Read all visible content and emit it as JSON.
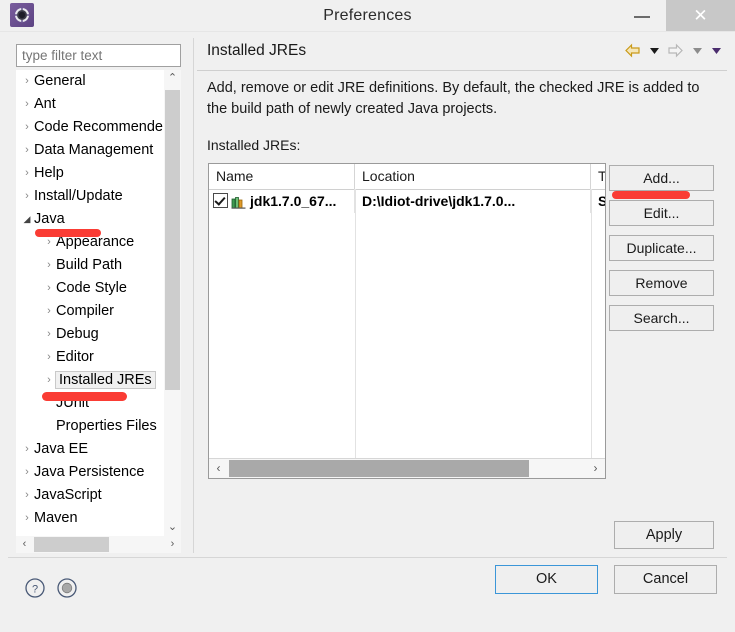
{
  "window": {
    "title": "Preferences",
    "icon": "eclipse-gear-icon",
    "minimize_label": "–",
    "maximize_label": "□",
    "close_label": "✕"
  },
  "sidebar": {
    "filter_placeholder": "type filter text",
    "filter_value": "",
    "items": [
      {
        "label": "General",
        "level": 0,
        "arrow": "collapsed"
      },
      {
        "label": "Ant",
        "level": 0,
        "arrow": "collapsed"
      },
      {
        "label": "Code Recommenders",
        "level": 0,
        "arrow": "collapsed"
      },
      {
        "label": "Data Management",
        "level": 0,
        "arrow": "collapsed"
      },
      {
        "label": "Help",
        "level": 0,
        "arrow": "collapsed"
      },
      {
        "label": "Install/Update",
        "level": 0,
        "arrow": "collapsed"
      },
      {
        "label": "Java",
        "level": 0,
        "arrow": "expanded"
      },
      {
        "label": "Appearance",
        "level": 1,
        "arrow": "collapsed"
      },
      {
        "label": "Build Path",
        "level": 1,
        "arrow": "collapsed"
      },
      {
        "label": "Code Style",
        "level": 1,
        "arrow": "collapsed"
      },
      {
        "label": "Compiler",
        "level": 1,
        "arrow": "collapsed"
      },
      {
        "label": "Debug",
        "level": 1,
        "arrow": "collapsed"
      },
      {
        "label": "Editor",
        "level": 1,
        "arrow": "collapsed"
      },
      {
        "label": "Installed JREs",
        "level": 1,
        "arrow": "collapsed",
        "selected": true
      },
      {
        "label": "JUnit",
        "level": 1,
        "arrow": "none"
      },
      {
        "label": "Properties Files",
        "level": 1,
        "arrow": "none"
      },
      {
        "label": "Java EE",
        "level": 0,
        "arrow": "collapsed"
      },
      {
        "label": "Java Persistence",
        "level": 0,
        "arrow": "collapsed"
      },
      {
        "label": "JavaScript",
        "level": 0,
        "arrow": "collapsed"
      },
      {
        "label": "Maven",
        "level": 0,
        "arrow": "collapsed"
      }
    ],
    "scroll_up_glyph": "⌃",
    "scroll_down_glyph": "⌄",
    "scroll_left_glyph": "‹",
    "scroll_right_glyph": "›"
  },
  "page": {
    "title": "Installed JREs",
    "description": "Add, remove or edit JRE definitions. By default, the checked JRE is added to the build path of newly created Java projects.",
    "list_label": "Installed JREs:",
    "nav": {
      "back_icon": "back-arrow-icon",
      "back_menu_icon": "chevron-down-icon",
      "forward_icon": "forward-arrow-icon",
      "forward_menu_icon": "chevron-down-icon",
      "more_menu_icon": "chevron-down-icon"
    }
  },
  "table": {
    "columns": [
      "Name",
      "Location",
      "Type"
    ],
    "rows": [
      {
        "checked": true,
        "icon": "jre-books-icon",
        "name": "jdk1.7.0_67...",
        "location": "D:\\Idiot-drive\\jdk1.7.0...",
        "type": "Stand"
      }
    ],
    "scroll_left_glyph": "‹",
    "scroll_right_glyph": "›"
  },
  "buttons": {
    "add": "Add...",
    "edit": "Edit...",
    "duplicate": "Duplicate...",
    "remove": "Remove",
    "search": "Search...",
    "apply": "Apply",
    "ok": "OK",
    "cancel": "Cancel"
  },
  "footer": {
    "help_icon": "question-mark-icon",
    "info_icon": "circle-dot-icon"
  },
  "annotations": {
    "color": "#fa3c34",
    "marks": [
      "under-java-tree-item",
      "under-installed-jres-tree-item",
      "under-add-button"
    ]
  }
}
